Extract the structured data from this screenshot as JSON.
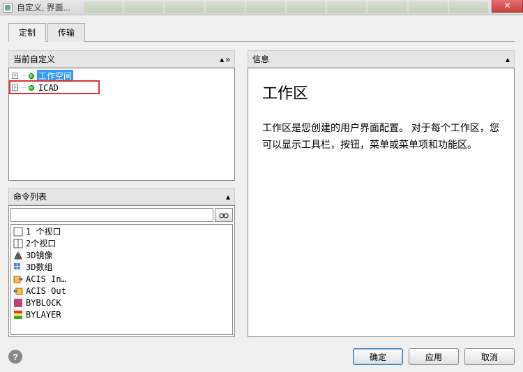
{
  "window": {
    "title": "自定义, 界面..."
  },
  "tabs": {
    "custom": "定制",
    "transfer": "传输"
  },
  "left": {
    "current_custom_header": "当前自定义",
    "tree": {
      "items": [
        {
          "label": "工作空间",
          "selected": true
        },
        {
          "label": "ICAD",
          "selected": false
        }
      ]
    },
    "command_list_header": "命令列表",
    "search_placeholder": "",
    "commands": [
      {
        "label": "1 个视口",
        "icon": "viewport1"
      },
      {
        "label": "2个视口",
        "icon": "viewport2"
      },
      {
        "label": "3D镜像",
        "icon": "mirror3d"
      },
      {
        "label": "3D数组",
        "icon": "array3d"
      },
      {
        "label": "ACIS In…",
        "icon": "acisin"
      },
      {
        "label": "ACIS Out",
        "icon": "acisout"
      },
      {
        "label": "BYBLOCK",
        "icon": "byblock"
      },
      {
        "label": "BYLAYER",
        "icon": "bylayer"
      }
    ]
  },
  "right": {
    "info_header": "信息",
    "info_title": "工作区",
    "info_body": "工作区是您创建的用户界面配置。 对于每个工作区，您可以显示工具栏，按钮，菜单或菜单项和功能区。"
  },
  "footer": {
    "ok": "确定",
    "apply": "应用",
    "cancel": "取消"
  }
}
